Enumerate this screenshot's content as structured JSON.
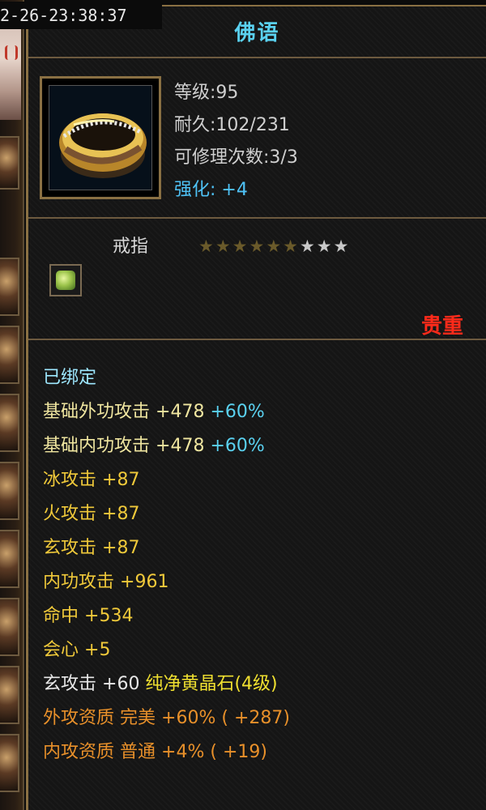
{
  "timestamp": "2-26-23:38:37",
  "item": {
    "name": "佛语",
    "type": "戒指",
    "level_text": "等级:95",
    "durability_text": "耐久:102/231",
    "repair_text": "可修理次数:3/3",
    "enhance_label": "强化:",
    "enhance_value": "+4",
    "stars_total": 9,
    "stars_lit": 6,
    "rarity": "贵重",
    "bound": "已绑定"
  },
  "attributes": [
    {
      "name": "基础外功攻击",
      "value": "+478",
      "extra": "+60%"
    },
    {
      "name": "基础内功攻击",
      "value": "+478",
      "extra": "+60%"
    },
    {
      "name": "冰攻击",
      "value": "+87"
    },
    {
      "name": "火攻击",
      "value": "+87"
    },
    {
      "name": "玄攻击",
      "value": "+87"
    },
    {
      "name": "内功攻击",
      "value": "+961"
    },
    {
      "name": "命中",
      "value": "+534"
    },
    {
      "name": "会心",
      "value": "+5"
    }
  ],
  "gem_line": {
    "name": "玄攻击",
    "value": "+60",
    "gem": "纯净黄晶石(4级)"
  },
  "quality": [
    {
      "name": "外攻资质",
      "grade": "完美",
      "value": "+60%",
      "bonus": "( +287)"
    },
    {
      "name": "内攻资质",
      "grade": "普通",
      "value": "+4%",
      "bonus": "( +19)"
    }
  ],
  "colors": {
    "title": "#5ad1f0",
    "bound": "#9ee8ff",
    "base_attr": "#f0e6a0",
    "percent": "#5ad1f0",
    "attr": "#f0c93a",
    "gem": "#f0e030",
    "quality": "#e8902a",
    "rarity": "#ff2a1a",
    "star_lit": "#6a5a2a",
    "star_dim": "#c8c8c8"
  }
}
